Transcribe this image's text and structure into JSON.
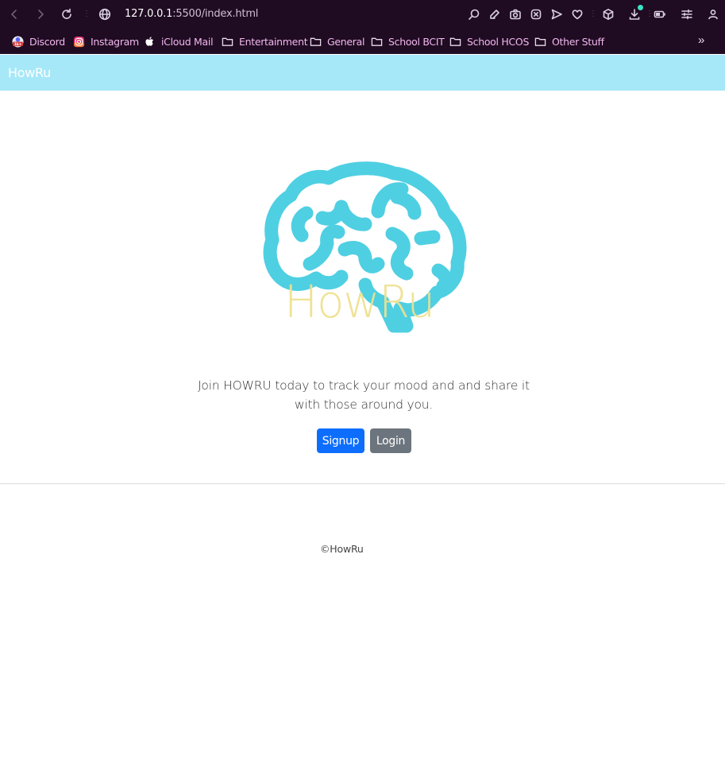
{
  "browser": {
    "url_host": "127.0.0.1",
    "url_path": ":5500/index.html",
    "bookmarks": [
      {
        "label": "Discord",
        "icon": "discord-icon"
      },
      {
        "label": "Instagram",
        "icon": "instagram-icon"
      },
      {
        "label": "iCloud Mail",
        "icon": "apple-icon"
      },
      {
        "label": "Entertainment",
        "icon": "folder-icon"
      },
      {
        "label": "General",
        "icon": "folder-icon"
      },
      {
        "label": "School BCIT",
        "icon": "folder-icon"
      },
      {
        "label": "School HCOS",
        "icon": "folder-icon"
      },
      {
        "label": "Other Stuff",
        "icon": "folder-icon"
      }
    ],
    "overflow": "»"
  },
  "navbar": {
    "brand": "HowRu",
    "color": "#a6e8f8"
  },
  "hero": {
    "logo_icon": "brain-icon",
    "logo_text": "HowRu",
    "logo_color": "#4fcfe2",
    "logo_text_color": "#efe190",
    "intro": "Join HOWRU today to track your mood and and share it with those around you."
  },
  "actions": {
    "signup_label": "Signup",
    "signup_color": "#0d6efd",
    "login_label": "Login",
    "login_color": "#6c757d"
  },
  "footer": {
    "text": "©HowRu"
  }
}
